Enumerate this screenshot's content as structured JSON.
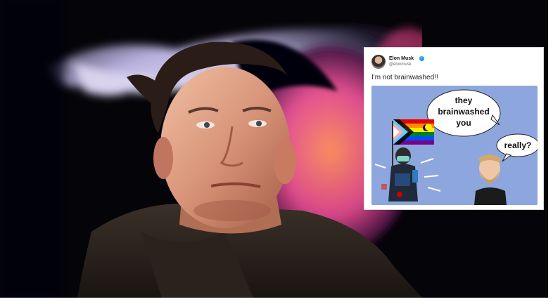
{
  "tweet": {
    "author_name": "Elon Musk",
    "author_handle": "@elonmusk",
    "verified_icon": "verified-badge-icon",
    "text": "I'm not brainwashed!!",
    "meme": {
      "left_speech": [
        "they",
        "brainwashed",
        "you"
      ],
      "right_speech": "really?"
    }
  },
  "colors": {
    "photo_background": "#000000",
    "twitter_blue": "#1d9bf0",
    "meme_background": "#8ea6de"
  }
}
